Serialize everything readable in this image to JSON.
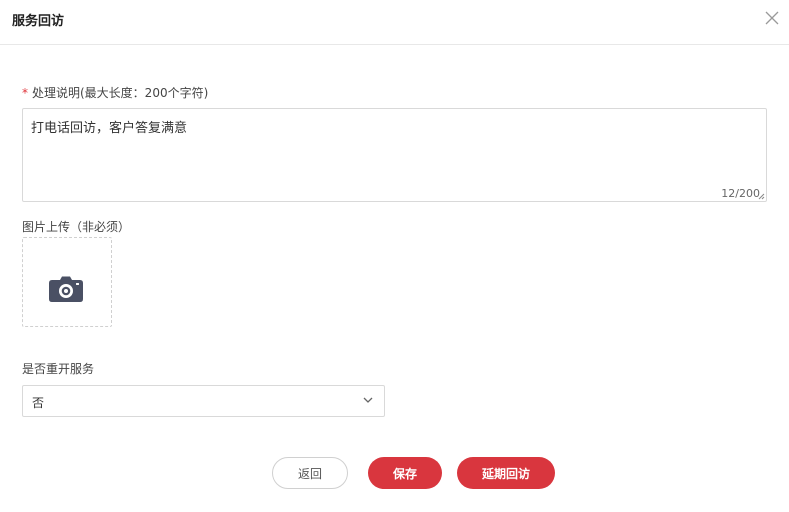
{
  "dialog": {
    "title": "服务回访",
    "close_icon": "close-icon"
  },
  "form": {
    "description": {
      "required_mark": "*",
      "label": "处理说明(最大长度：200个字符)",
      "value": "打电话回访，客户答复满意",
      "counter": "12/200"
    },
    "image_upload": {
      "label": "图片上传（非必须）",
      "icon": "camera-icon"
    },
    "reopen": {
      "label": "是否重开服务",
      "selected": "否",
      "icon": "chevron-down-icon"
    }
  },
  "buttons": {
    "back": "返回",
    "save": "保存",
    "delay": "延期回访"
  },
  "colors": {
    "primary": "#d9363e",
    "border": "#d9d9d9",
    "icon": "#4a5064"
  }
}
